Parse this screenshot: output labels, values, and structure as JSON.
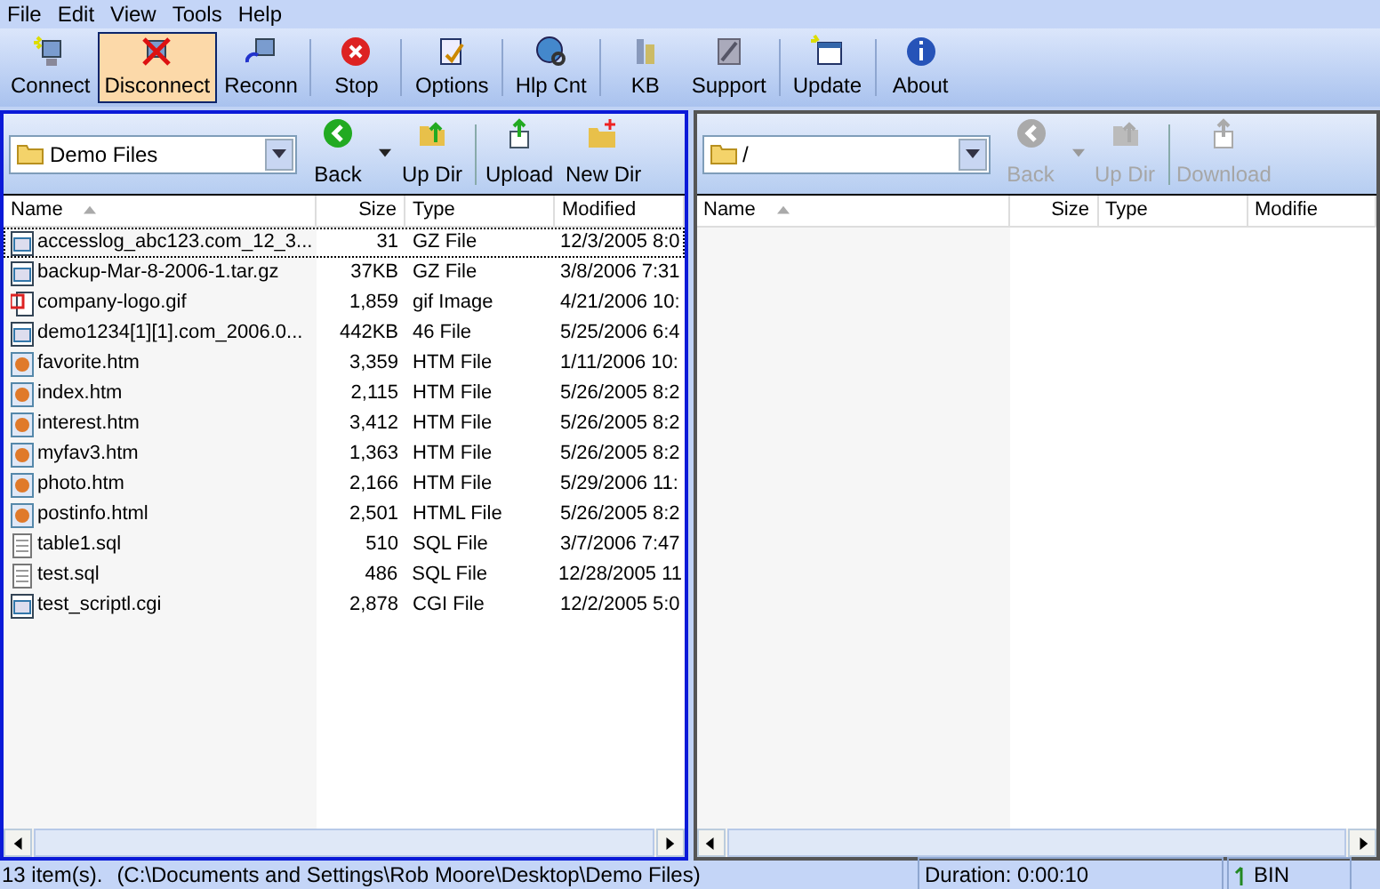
{
  "menu": [
    "File",
    "Edit",
    "View",
    "Tools",
    "Help"
  ],
  "toolbar": [
    {
      "label": "Connect",
      "kind": "connect",
      "highlighted": false
    },
    {
      "label": "Disconnect",
      "kind": "disconnect",
      "highlighted": true
    },
    {
      "label": "Reconn",
      "kind": "reconnect",
      "highlighted": false
    },
    {
      "label": "Stop",
      "kind": "stop",
      "highlighted": false
    },
    {
      "label": "Options",
      "kind": "options",
      "highlighted": false
    },
    {
      "label": "Hlp Cnt",
      "kind": "help",
      "highlighted": false
    },
    {
      "label": "KB",
      "kind": "kb",
      "highlighted": false
    },
    {
      "label": "Support",
      "kind": "support",
      "highlighted": false
    },
    {
      "label": "Update",
      "kind": "update",
      "highlighted": false
    },
    {
      "label": "About",
      "kind": "about",
      "highlighted": false
    }
  ],
  "local": {
    "active": true,
    "path": "Demo Files",
    "buttons": [
      {
        "label": "Back",
        "kind": "back",
        "disabled": false
      },
      {
        "label": "Up Dir",
        "kind": "updir",
        "disabled": false
      },
      {
        "label": "Upload",
        "kind": "transfer",
        "disabled": false
      },
      {
        "label": "New Dir",
        "kind": "newdir",
        "disabled": false
      }
    ],
    "columns": [
      "Name",
      "Size",
      "Type",
      "Modified"
    ],
    "rows": [
      {
        "name": "accesslog_abc123.com_12_3...",
        "size": "31",
        "type": "GZ File",
        "modified": "12/3/2005 8:0",
        "kind": "archive",
        "selected": true
      },
      {
        "name": "backup-Mar-8-2006-1.tar.gz",
        "size": "37KB",
        "type": "GZ File",
        "modified": "3/8/2006 7:31",
        "kind": "archive",
        "selected": false
      },
      {
        "name": "company-logo.gif",
        "size": "1,859",
        "type": "gif Image",
        "modified": "4/21/2006 10:",
        "kind": "image",
        "selected": false
      },
      {
        "name": "demo1234[1][1].com_2006.0...",
        "size": "442KB",
        "type": "46 File",
        "modified": "5/25/2006 6:4",
        "kind": "archive",
        "selected": false
      },
      {
        "name": "favorite.htm",
        "size": "3,359",
        "type": "HTM File",
        "modified": "1/11/2006 10:",
        "kind": "web",
        "selected": false
      },
      {
        "name": "index.htm",
        "size": "2,115",
        "type": "HTM File",
        "modified": "5/26/2005 8:2",
        "kind": "web",
        "selected": false
      },
      {
        "name": "interest.htm",
        "size": "3,412",
        "type": "HTM File",
        "modified": "5/26/2005 8:2",
        "kind": "web",
        "selected": false
      },
      {
        "name": "myfav3.htm",
        "size": "1,363",
        "type": "HTM File",
        "modified": "5/26/2005 8:2",
        "kind": "web",
        "selected": false
      },
      {
        "name": "photo.htm",
        "size": "2,166",
        "type": "HTM File",
        "modified": "5/29/2006 11:",
        "kind": "web",
        "selected": false
      },
      {
        "name": "postinfo.html",
        "size": "2,501",
        "type": "HTML File",
        "modified": "5/26/2005 8:2",
        "kind": "web",
        "selected": false
      },
      {
        "name": "table1.sql",
        "size": "510",
        "type": "SQL File",
        "modified": "3/7/2006 7:47",
        "kind": "text",
        "selected": false
      },
      {
        "name": "test.sql",
        "size": "486",
        "type": "SQL File",
        "modified": "12/28/2005 11",
        "kind": "text",
        "selected": false
      },
      {
        "name": "test_scriptl.cgi",
        "size": "2,878",
        "type": "CGI File",
        "modified": "12/2/2005 5:0",
        "kind": "archive",
        "selected": false
      }
    ]
  },
  "remote": {
    "active": false,
    "path": "/",
    "buttons": [
      {
        "label": "Back",
        "kind": "back",
        "disabled": true
      },
      {
        "label": "Up Dir",
        "kind": "updir",
        "disabled": true
      },
      {
        "label": "Download",
        "kind": "transfer",
        "disabled": true
      }
    ],
    "columns": [
      "Name",
      "Size",
      "Type",
      "Modifie"
    ]
  },
  "status_bar": {
    "items": "13 item(s).",
    "path": "(C:\\Documents and Settings\\Rob Moore\\Desktop\\Demo Files)",
    "duration": "Duration: 0:00:10",
    "mode": "BIN"
  }
}
